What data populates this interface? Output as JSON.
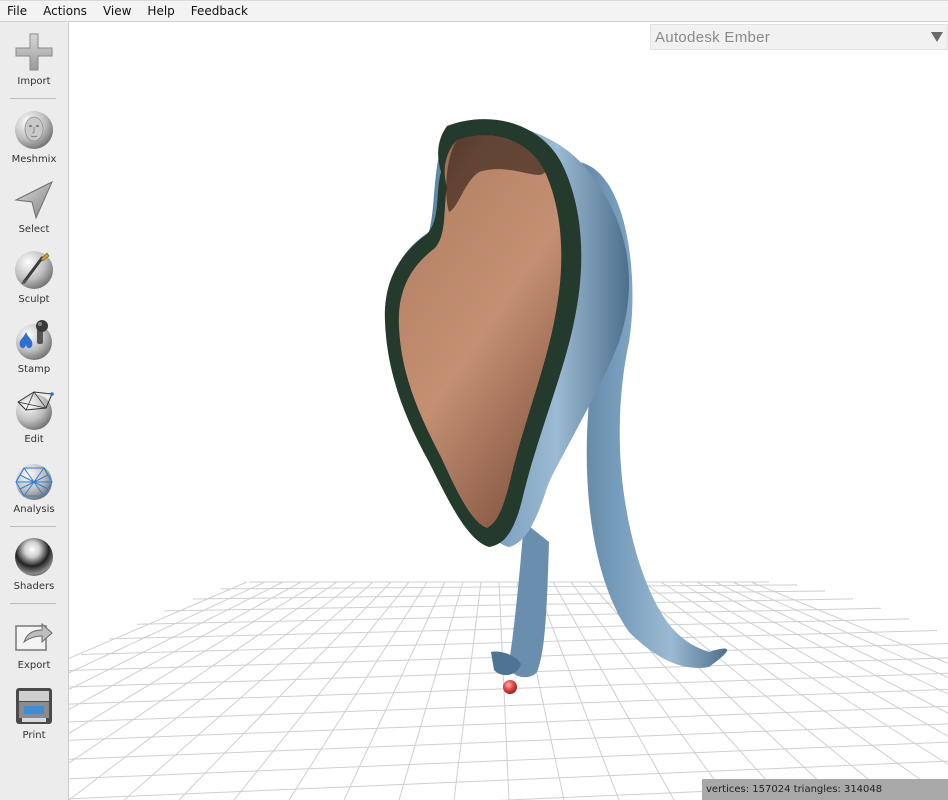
{
  "menu": {
    "file": "File",
    "actions": "Actions",
    "view": "View",
    "help": "Help",
    "feedback": "Feedback"
  },
  "toolbar": {
    "items": [
      {
        "label": "Import",
        "icon": "plus-icon"
      },
      {
        "label": "Meshmix",
        "icon": "face-sphere-icon"
      },
      {
        "label": "Select",
        "icon": "arrow-pointer-icon"
      },
      {
        "label": "Sculpt",
        "icon": "brush-sphere-icon"
      },
      {
        "label": "Stamp",
        "icon": "fleur-stamp-icon"
      },
      {
        "label": "Edit",
        "icon": "wireframe-sphere-icon"
      },
      {
        "label": "Analysis",
        "icon": "mesh-sphere-icon"
      },
      {
        "label": "Shaders",
        "icon": "chrome-sphere-icon"
      },
      {
        "label": "Export",
        "icon": "export-icon"
      },
      {
        "label": "Print",
        "icon": "printer-icon"
      }
    ]
  },
  "viewport": {
    "printer_selected": "Autodesk Ember",
    "status": "vertices: 157024  triangles: 314048"
  },
  "colors": {
    "shell_outer": "#5f86a6",
    "shell_inner": "#a9755c",
    "rim": "#243a2c",
    "pivot": "#e04848"
  }
}
